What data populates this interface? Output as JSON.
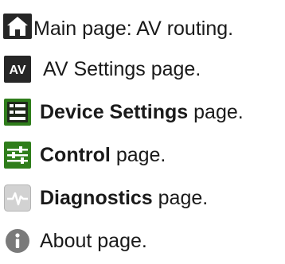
{
  "rows": [
    {
      "key": "main",
      "icon": "home-icon",
      "bold": "",
      "text": "Main page: AV routing."
    },
    {
      "key": "av",
      "icon": "av-badge-icon",
      "icon_text": "AV",
      "bold": "",
      "text": "AV Settings page."
    },
    {
      "key": "device",
      "icon": "device-settings-icon",
      "bold": "Device Settings",
      "text": " page."
    },
    {
      "key": "control",
      "icon": "sliders-icon",
      "bold": "Control",
      "text": " page."
    },
    {
      "key": "diagnostics",
      "icon": "pulse-icon",
      "bold": "Diagnostics",
      "text": " page."
    },
    {
      "key": "about",
      "icon": "info-icon",
      "bold": "",
      "text": "About page."
    }
  ],
  "colors": {
    "icon_dark": "#262626",
    "icon_green": "#2f7d1b",
    "icon_gray": "#7a7a7a",
    "pulse_bg": "#d2d2d2",
    "text": "#1a1a1a"
  }
}
